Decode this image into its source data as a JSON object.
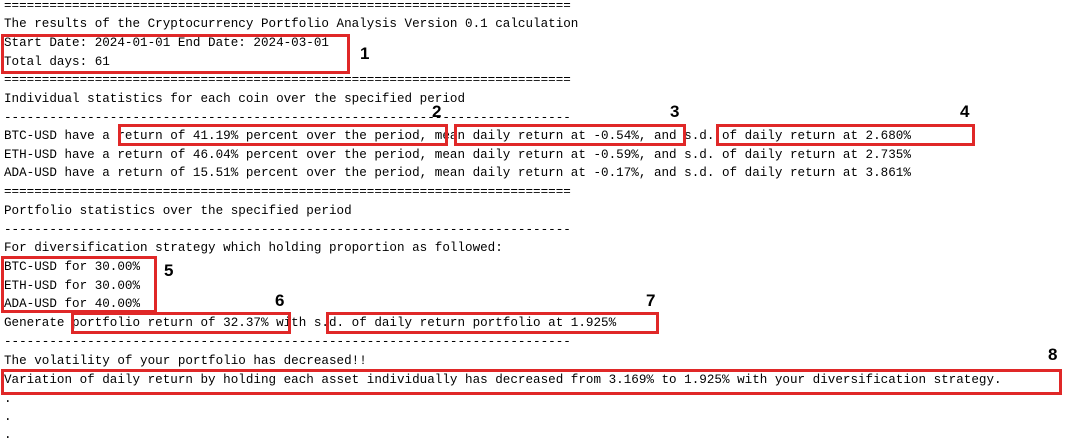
{
  "console": {
    "separator_eq": "===========================================================================",
    "separator_dash": "---------------------------------------------------------------------------",
    "title": "The results of the Cryptocurrency Portfolio Analysis Version 0.1 calculation",
    "date_range": "Start Date: 2024-01-01 End Date: 2024-03-01",
    "total_days": "Total days: 61",
    "individual_heading": "Individual statistics for each coin over the specified period",
    "coin_lines": [
      "BTC-USD have a return of 41.19% percent over the period, mean daily return at -0.54%, and s.d. of daily return at 2.680%",
      "ETH-USD have a return of 46.04% percent over the period, mean daily return at -0.59%, and s.d. of daily return at 2.735%",
      "ADA-USD have a return of 15.51% percent over the period, mean daily return at -0.17%, and s.d. of daily return at 3.861%"
    ],
    "portfolio_heading": "Portfolio statistics over the specified period",
    "strategy_intro": "For diversification strategy which holding proportion as followed:",
    "holdings": [
      "BTC-USD for 30.00%",
      "ETH-USD for 30.00%",
      "ADA-USD for 40.00%"
    ],
    "generate_line": "Generate portfolio return of 32.37% with s.d. of daily return portfolio at 1.925%",
    "volatility_note": "The volatility of your portfolio has decreased!!",
    "variation_line": "Variation of daily return by holding each asset individually has decreased from 3.169% to 1.925% with your diversification strategy.",
    "dots": [
      ".",
      ".",
      "."
    ]
  },
  "annotations": {
    "labels": [
      "1",
      "2",
      "3",
      "4",
      "5",
      "6",
      "7",
      "8"
    ],
    "box_color": "#e02828"
  }
}
